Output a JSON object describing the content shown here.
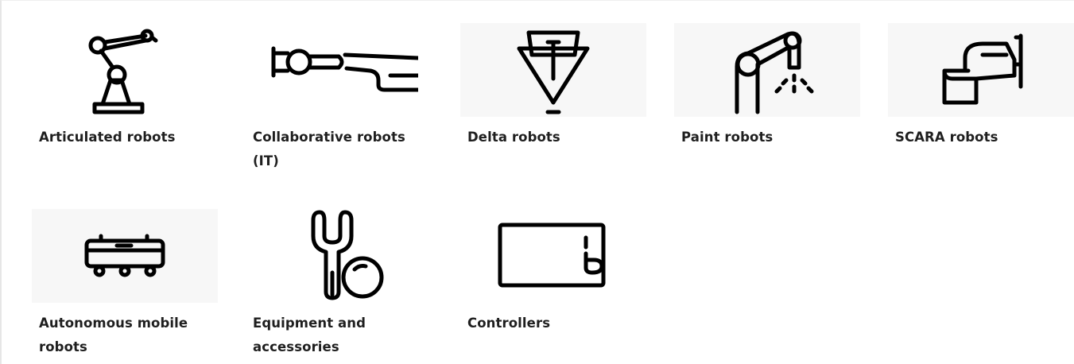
{
  "categories": [
    {
      "label": "Articulated robots",
      "icon": "articulated-robot-icon"
    },
    {
      "label": "Collaborative robots (IT)",
      "icon": "collaborative-robot-icon"
    },
    {
      "label": "Delta robots",
      "icon": "delta-robot-icon"
    },
    {
      "label": "Paint robots",
      "icon": "paint-robot-icon"
    },
    {
      "label": "SCARA robots",
      "icon": "scara-robot-icon"
    },
    {
      "label": "Autonomous mobile robots",
      "icon": "mobile-robot-icon"
    },
    {
      "label": "Equipment and accessories",
      "icon": "gripper-icon"
    },
    {
      "label": "Controllers",
      "icon": "controller-icon"
    }
  ],
  "colors": {
    "text": "#1f1f1f",
    "icon": "#000000",
    "tile_background": "#f7f7f7",
    "page_background": "#ffffff"
  }
}
